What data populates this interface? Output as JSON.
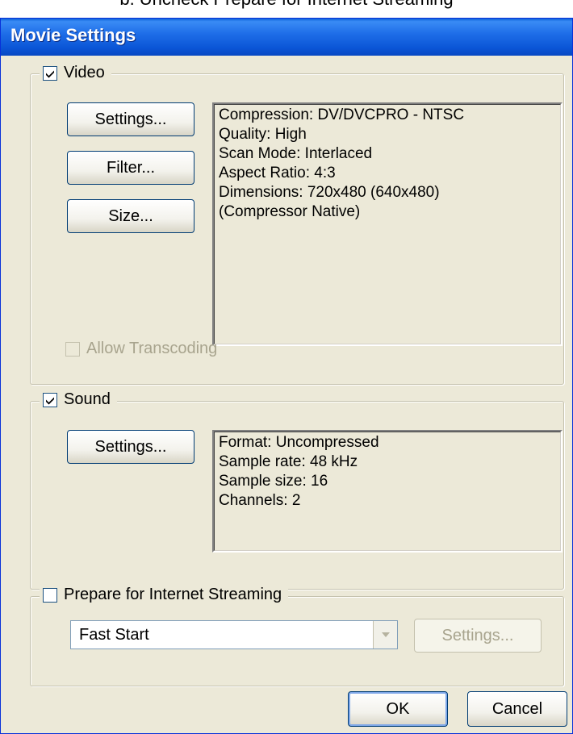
{
  "caption": "b. Uncheck Prepare for Internet Streaming",
  "window": {
    "title": "Movie Settings"
  },
  "video": {
    "label": "Video",
    "checked": true,
    "buttons": {
      "settings": "Settings...",
      "filter": "Filter...",
      "size": "Size..."
    },
    "info": [
      "Compression: DV/DVCPRO - NTSC",
      "Quality: High",
      "Scan Mode: Interlaced",
      "Aspect Ratio: 4:3",
      "Dimensions: 720x480 (640x480)",
      "(Compressor Native)"
    ],
    "allow_transcoding": {
      "label": "Allow Transcoding",
      "checked": false,
      "enabled": false
    }
  },
  "sound": {
    "label": "Sound",
    "checked": true,
    "buttons": {
      "settings": "Settings..."
    },
    "info": [
      "Format: Uncompressed",
      "Sample rate: 48 kHz",
      "Sample size: 16",
      "Channels: 2"
    ]
  },
  "streaming": {
    "label": "Prepare for Internet Streaming",
    "checked": false,
    "selected": "Fast Start",
    "settings_label": "Settings..."
  },
  "footer": {
    "ok": "OK",
    "cancel": "Cancel"
  },
  "colors": {
    "title_bar": "#0a55d6",
    "dialog_bg": "#ece9d8",
    "button_border": "#003c74"
  }
}
